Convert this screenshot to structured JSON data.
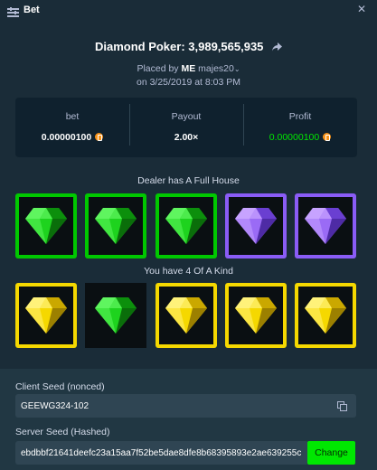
{
  "window": {
    "title": "Bet"
  },
  "bet": {
    "headline": "Diamond Poker: 3,989,565,935",
    "placed_by_prefix": "Placed by",
    "user_tag": "ME",
    "username": "majes20",
    "timestamp": "on 3/25/2019 at 8:03 PM"
  },
  "stats": {
    "bet_label": "bet",
    "bet_value": "0.00000100",
    "payout_label": "Payout",
    "payout_value": "2.00×",
    "profit_label": "Profit",
    "profit_value": "0.00000100"
  },
  "dealer": {
    "label": "Dealer has A Full House",
    "cards": [
      {
        "gem": "green",
        "frame": "green"
      },
      {
        "gem": "green",
        "frame": "green"
      },
      {
        "gem": "green",
        "frame": "green"
      },
      {
        "gem": "purple",
        "frame": "purple"
      },
      {
        "gem": "purple",
        "frame": "purple"
      }
    ]
  },
  "player": {
    "label": "You have 4 Of A Kind",
    "cards": [
      {
        "gem": "yellow",
        "frame": "yellow"
      },
      {
        "gem": "green",
        "frame": "none"
      },
      {
        "gem": "yellow",
        "frame": "yellow"
      },
      {
        "gem": "yellow",
        "frame": "yellow"
      },
      {
        "gem": "yellow",
        "frame": "yellow"
      }
    ]
  },
  "seeds": {
    "client_label": "Client Seed (nonced)",
    "client_value": "GEEWG324-102",
    "server_label": "Server Seed (Hashed)",
    "server_value": "ebdbbf21641deefc23a15aa7f52be5dae8dfe8b68395893e2ae639255c",
    "change_label": "Change"
  },
  "colors": {
    "background": "#1a2c38",
    "panel": "#0f212e",
    "accent_green": "#00e701",
    "gem_green": "#1ed31e",
    "gem_purple": "#8a5cf6",
    "gem_yellow": "#f5d800"
  },
  "icons": {
    "title": "bet-list-icon",
    "close": "close-icon",
    "share": "share-arrow-icon",
    "currency": "bitcoin-icon",
    "copy": "copy-icon",
    "gem": "diamond-icon"
  }
}
